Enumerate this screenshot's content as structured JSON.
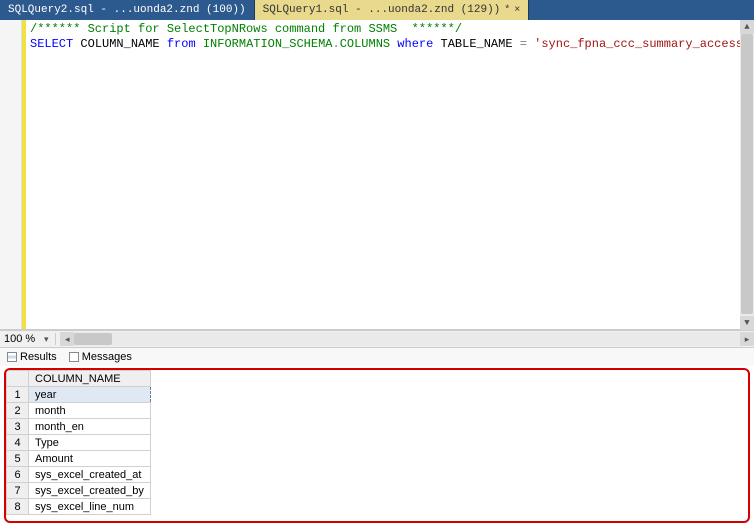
{
  "tabs": {
    "items": [
      {
        "label": "SQLQuery2.sql - ...uonda2.znd (100))",
        "active": false
      },
      {
        "label": "SQLQuery1.sql - ...uonda2.znd (129))",
        "active": true
      }
    ],
    "modified_indicator": "*",
    "close_glyph": "×"
  },
  "editor": {
    "comment": "/****** Script for SelectTopNRows command from SSMS  ******/",
    "line2": {
      "select": "SELECT",
      "col": " COLUMN_NAME ",
      "from": "from",
      "schema": " INFORMATION_SCHEMA",
      "dot": ".",
      "table_src": "COLUMNS ",
      "where": "where",
      "tblname": " TABLE_NAME ",
      "eq": "=",
      "str": " 'sync_fpna_ccc_summary_access_monthly'"
    }
  },
  "zoom": {
    "value": "100 %"
  },
  "panel": {
    "results_label": "Results",
    "messages_label": "Messages"
  },
  "grid": {
    "column_header": "COLUMN_NAME",
    "rows": [
      {
        "n": "1",
        "v": "year"
      },
      {
        "n": "2",
        "v": "month"
      },
      {
        "n": "3",
        "v": "month_en"
      },
      {
        "n": "4",
        "v": "Type"
      },
      {
        "n": "5",
        "v": "Amount"
      },
      {
        "n": "6",
        "v": "sys_excel_created_at"
      },
      {
        "n": "7",
        "v": "sys_excel_created_by"
      },
      {
        "n": "8",
        "v": "sys_excel_line_num"
      }
    ]
  }
}
